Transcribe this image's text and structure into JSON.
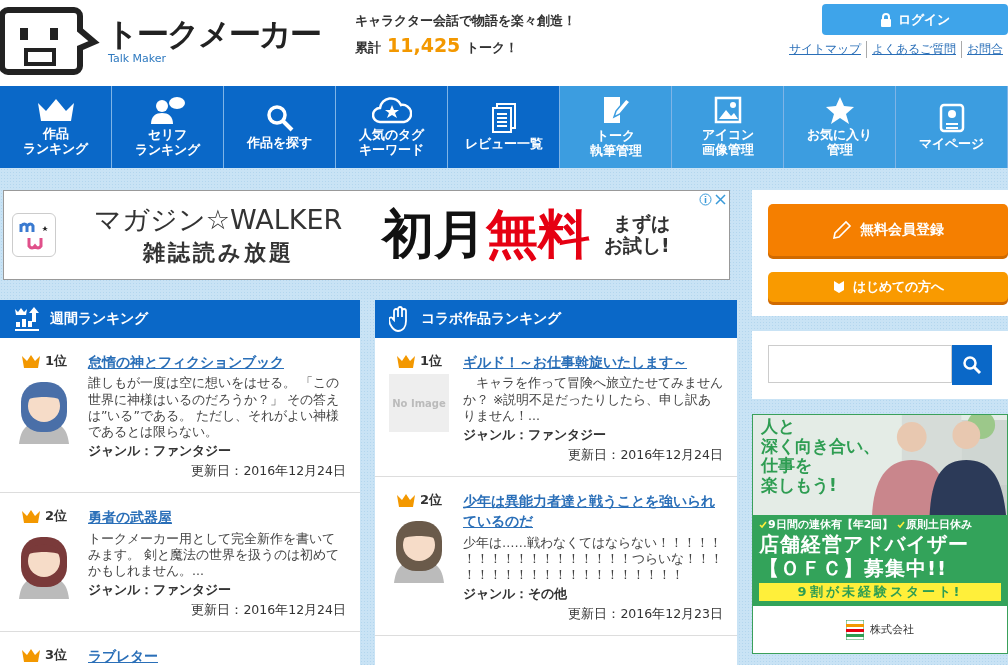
{
  "header": {
    "logo_title": "トークメーカー",
    "logo_subtitle": "Talk Maker",
    "tagline": "キャラクター会話で物語を楽々創造！",
    "total_label": "累計",
    "total_count": "11,425",
    "total_unit": "トーク！",
    "login": "ログイン",
    "links": [
      "サイトマップ",
      "よくあるご質問",
      "お問合"
    ]
  },
  "nav": [
    {
      "lines": [
        "作品",
        "ランキング"
      ],
      "kind": "main"
    },
    {
      "lines": [
        "セリフ",
        "ランキング"
      ],
      "kind": "main"
    },
    {
      "lines": [
        "作品を探す"
      ],
      "kind": "main"
    },
    {
      "lines": [
        "人気のタグ",
        "キーワード"
      ],
      "kind": "main"
    },
    {
      "lines": [
        "レビュー一覧"
      ],
      "kind": "main"
    },
    {
      "lines": [
        "トーク",
        "執筆管理"
      ],
      "kind": "member"
    },
    {
      "lines": [
        "アイコン",
        "画像管理"
      ],
      "kind": "member"
    },
    {
      "lines": [
        "お気に入り",
        "管理"
      ],
      "kind": "member"
    },
    {
      "lines": [
        "マイページ"
      ],
      "kind": "member"
    }
  ],
  "ad_banner": {
    "brand": "マガジン☆WALKER",
    "subtitle": "雑誌読み放題",
    "headline": [
      {
        "text": "初月",
        "kind": "plain"
      },
      {
        "text": "無料",
        "kind": "accent"
      }
    ],
    "side_lines": [
      "まずは",
      "お試し!"
    ]
  },
  "rankings": [
    {
      "title": "週間ランキング",
      "items": [
        {
          "rank": "1位",
          "title": "怠惰の神とフィクションブック",
          "description": "誰しもが一度は空に想いをはせる。 「この世界に神様はいるのだろうか？」 その答えは”いる”である。 ただし、それがよい神様であるとは限らない。",
          "genre": "ジャンル：ファンタジー",
          "updated": "更新日：2016年12月24日"
        },
        {
          "rank": "2位",
          "title": "勇者の武器屋",
          "description": "トークメーカー用として完全新作を書いてみます。 剣と魔法の世界を扱うのは初めてかもしれません。...",
          "genre": "ジャンル：ファンタジー",
          "updated": "更新日：2016年12月24日"
        },
        {
          "rank": "3位",
          "title": "ラブレター"
        }
      ]
    },
    {
      "title": "コラボ作品ランキング",
      "items": [
        {
          "rank": "1位",
          "title": "ギルド！～お仕事斡旋いたします～",
          "no_image": "No Image",
          "description": "　キャラを作って冒険へ旅立たせてみませんか？ ※説明不足だったりしたら、申し訳ありません！...",
          "genre": "ジャンル：ファンタジー",
          "updated": "更新日：2016年12月24日"
        },
        {
          "rank": "2位",
          "title": "少年は異能力者達と戦うことを強いられているのだ",
          "description": "少年は……戦わなくてはならない！！！！！！！！！！！！！！！！！！つらいな！！！！！！！！！！！！！！！！！！！！",
          "genre": "ジャンル：その他",
          "updated": "更新日：2016年12月23日"
        }
      ]
    }
  ],
  "sidebar": {
    "register": "無料会員登録",
    "beginners": "はじめての方へ"
  },
  "job_ad": {
    "headline": [
      "人と",
      "深く向き合い、",
      "仕事を",
      "楽しもう!"
    ],
    "perks": [
      "9日間の連休有【年2回】",
      "原則土日休み"
    ],
    "title_lines": [
      "店舗経営アドバイザー",
      "【ＯＦＣ】募集中!!"
    ],
    "banner": "9割が未経験スタート!",
    "company": "株式会社"
  }
}
